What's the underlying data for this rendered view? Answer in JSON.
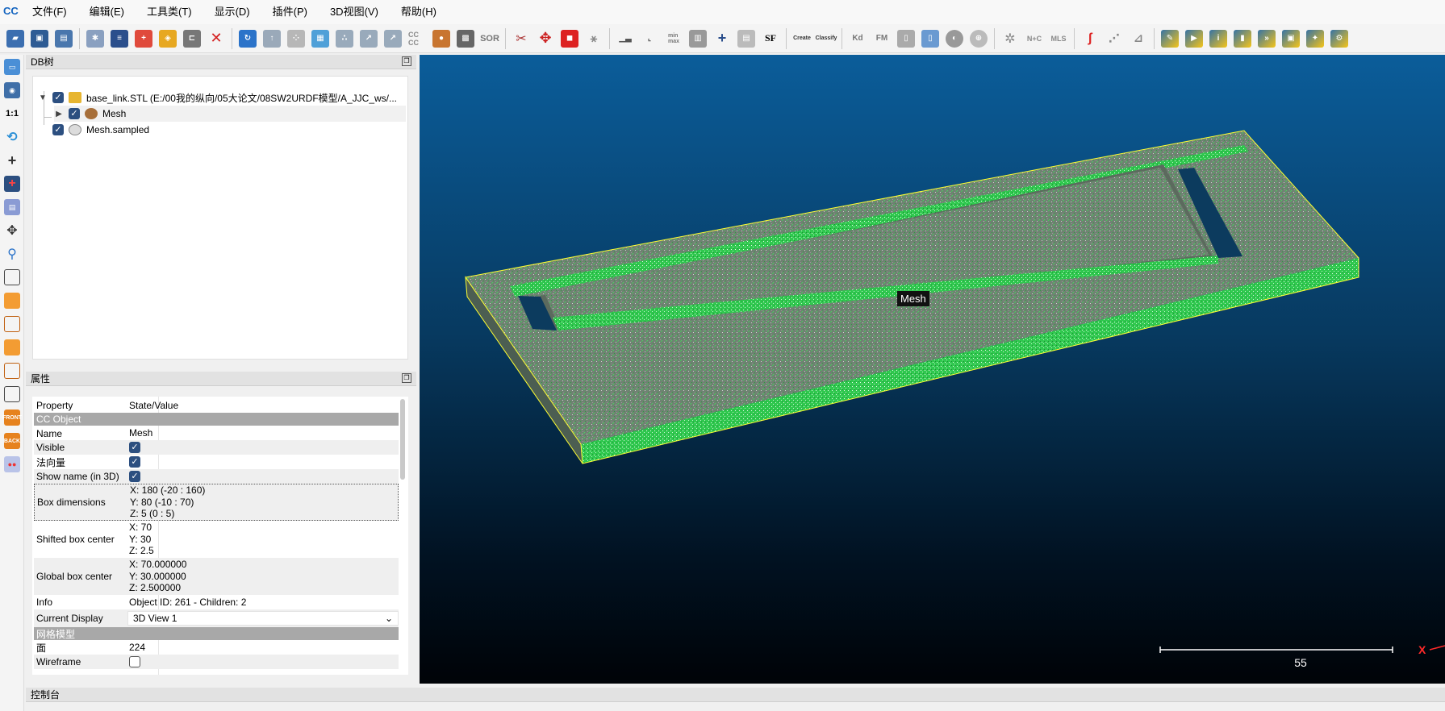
{
  "app": {
    "icon": "cloudcompare-logo-icon"
  },
  "menu": [
    "文件(F)",
    "编辑(E)",
    "工具类(T)",
    "显示(D)",
    "插件(P)",
    "3D视图(V)",
    "帮助(H)"
  ],
  "toolbar": {
    "labels": {
      "sor": "SOR",
      "cc": "CC\nCC",
      "sf": "SF",
      "kd": "Kd",
      "fm": "FM",
      "ncm": "N+C",
      "mls": "MLS",
      "canupo_create": "Create",
      "canupo_classify": "Classify",
      "min": "min\nmax"
    }
  },
  "panels": {
    "db_title": "DB树",
    "properties_title": "属性",
    "console_title": "控制台"
  },
  "db_tree": [
    {
      "label": "base_link.STL (E:/00我的纵向/05大论文/08SW2URDF模型/A_JJC_ws/...",
      "checked": true,
      "expanded": true
    },
    {
      "label": "Mesh",
      "checked": true,
      "expanded": false
    },
    {
      "label": "Mesh.sampled",
      "checked": true
    }
  ],
  "properties": {
    "header_key": "Property",
    "header_value": "State/Value",
    "section_cc": "CC Object",
    "name_k": "Name",
    "name_v": "Mesh",
    "visible_k": "Visible",
    "visible_v": true,
    "normals_k": "法向量",
    "normals_v": true,
    "showname_k": "Show name (in 3D)",
    "showname_v": true,
    "box_k": "Box dimensions",
    "box_x": "X: 180 (-20 : 160)",
    "box_y": "Y: 80 (-10 : 70)",
    "box_z": "Z: 5 (0 : 5)",
    "shifted_k": "Shifted box center",
    "shifted_x": "X: 70",
    "shifted_y": "Y: 30",
    "shifted_z": "Z: 2.5",
    "global_k": "Global box center",
    "global_x": "X: 70.000000",
    "global_y": "Y: 30.000000",
    "global_z": "Z: 2.500000",
    "info_k": "Info",
    "info_v": "Object ID: 261 - Children: 2",
    "display_k": "Current Display",
    "display_v": "3D View 1",
    "section_mesh": "网格模型",
    "faces_k": "面",
    "faces_v": "224",
    "wire_k": "Wireframe",
    "wire_v": false
  },
  "view": {
    "mesh_label": "Mesh",
    "scale_value": "55",
    "axis_label": "X",
    "colors": {
      "mesh_surface": "#6f8f70",
      "mesh_edge": "#44dd66",
      "bbox": "#ffff33",
      "background_top": "#0b5d9a",
      "background_bottom": "#000307"
    }
  }
}
